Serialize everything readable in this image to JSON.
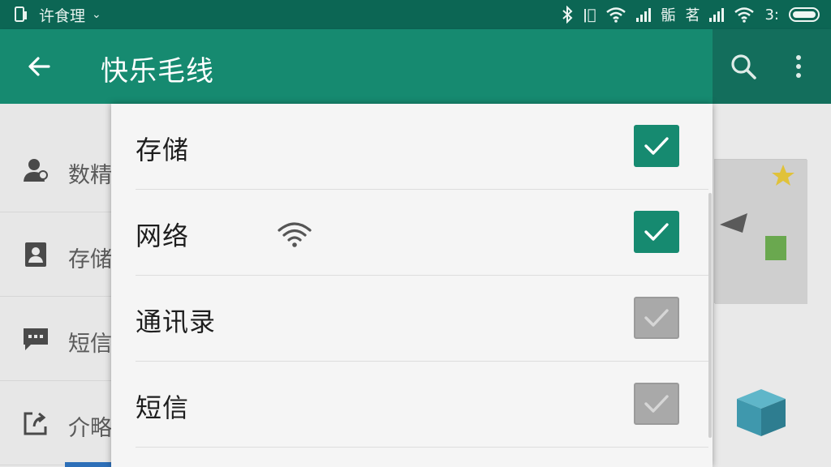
{
  "status_bar": {
    "app_label": "许食理",
    "carrier_text_1": "ǀ⃝",
    "carrier_text_2": "骺",
    "carrier_text_3": "茗",
    "time": "3:"
  },
  "app_bar": {
    "title": "快乐毛线",
    "back_icon": "arrow-left-icon",
    "search_icon": "search-icon",
    "more_icon": "more-vert-icon"
  },
  "background_list": {
    "items": [
      {
        "label": "数精",
        "icon": "person-icon"
      },
      {
        "label": "存储",
        "icon": "contact-card-icon"
      },
      {
        "label": "短信",
        "icon": "message-icon"
      },
      {
        "label": "介略",
        "icon": "share-icon"
      }
    ]
  },
  "dialog": {
    "items": [
      {
        "label": "存储",
        "checked": true
      },
      {
        "label": "网络",
        "checked": true,
        "icon": "wifi-icon"
      },
      {
        "label": "通讯录",
        "checked": false
      },
      {
        "label": "短信",
        "checked": false
      }
    ]
  },
  "colors": {
    "accent": "#168a70",
    "status_bar": "#0c6654",
    "unchecked": "#a9a9a9"
  }
}
